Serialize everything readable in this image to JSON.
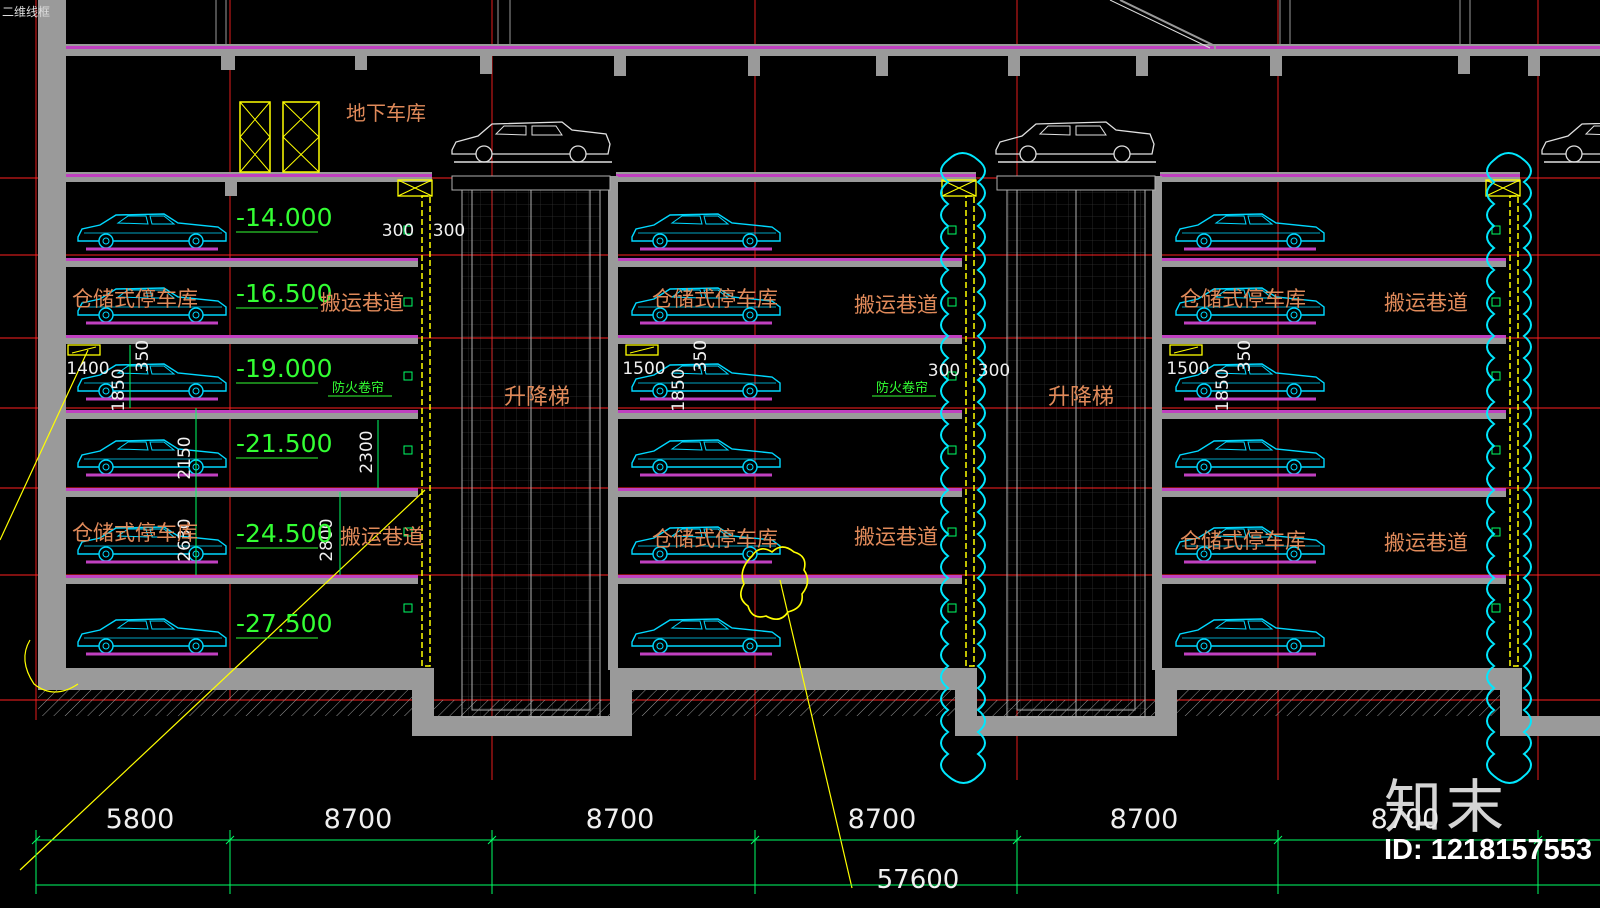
{
  "viewport_label": "二维线框",
  "labels": {
    "underground_garage": "地下车库",
    "storage_parking": "仓储式停车库",
    "transport_aisle": "搬运巷道",
    "lift": "升降梯",
    "fire_shutter": "防火卷帘"
  },
  "elevations": [
    "-14.000",
    "-16.500",
    "-19.000",
    "-21.500",
    "-24.500",
    "-27.500"
  ],
  "dimensions": {
    "spans": [
      "5800",
      "8700",
      "8700",
      "8700",
      "8700",
      "8700"
    ],
    "total": "57600",
    "small": [
      "300",
      "300",
      "300",
      "300",
      "1400",
      "1500",
      "1500",
      "350",
      "350",
      "350",
      "1850",
      "1850",
      "1850",
      "2150",
      "2300",
      "2630",
      "2800"
    ]
  },
  "watermark": {
    "logo": "知末",
    "id": "ID: 1218157553"
  },
  "colors": {
    "background": "#000000",
    "slab": "#c040c0",
    "wall": "#9a9a9a",
    "car": "#00d8ff",
    "level_text": "#33ff33",
    "label_text": "#e08a5a",
    "dim_text": "#f0f0f0",
    "axis_line": "#ff2020",
    "yellow": "#ffff00",
    "cyan_cloud": "#00e8ff"
  }
}
